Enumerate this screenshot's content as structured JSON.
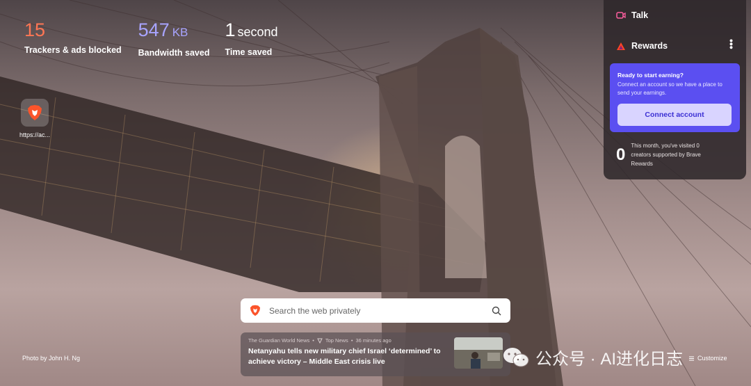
{
  "stats": {
    "trackers": {
      "value": "15",
      "label": "Trackers & ads blocked"
    },
    "bandwidth": {
      "value": "547",
      "unit": "KB",
      "label": "Bandwidth saved"
    },
    "time": {
      "value": "1",
      "unit": "second",
      "label": "Time saved"
    }
  },
  "top_sites": [
    {
      "label": "https://ac...",
      "icon": "brave-lion-icon"
    }
  ],
  "widgets": {
    "talk": {
      "label": "Talk",
      "icon": "video-camera-icon"
    },
    "rewards": {
      "label": "Rewards",
      "icon": "bat-triangle-icon",
      "card_title": "Ready to start earning?",
      "card_desc": "Connect an account so we have a place to send your earnings.",
      "connect_label": "Connect account",
      "visited_count": "0",
      "visited_text": "This month, you've visited 0 creators supported by Brave Rewards"
    }
  },
  "search": {
    "placeholder": "Search the web privately",
    "icon": "search-icon"
  },
  "news": {
    "source": "The Guardian World News",
    "category": "Top News",
    "time": "36 minutes ago",
    "headline": "Netanyahu tells new military chief Israel ‘determined’ to achieve victory – Middle East crisis live"
  },
  "footer": {
    "credit": "Photo by John H. Ng",
    "customize": "Customize"
  },
  "watermark": "公众号 · AI进化日志",
  "colors": {
    "trackers": "#ff7654",
    "bandwidth": "#a8a4ff",
    "rewards_card": "#5b4ff1"
  }
}
